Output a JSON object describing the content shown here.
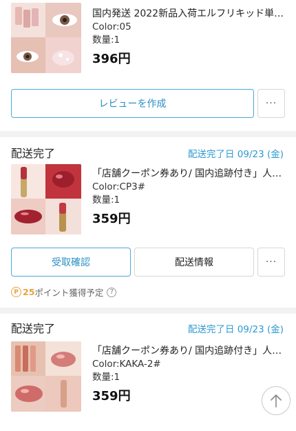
{
  "orders": [
    {
      "product": {
        "title": "国内発送 2022新品入荷エルフリキッド単色ア…",
        "color": "Color:05",
        "quantity": "数量:1",
        "price": "396円",
        "thumb_icon": "eyeshadow-product-photo"
      },
      "buttons": {
        "review": "レビューを作成",
        "more": "···"
      }
    },
    {
      "status": "配送完了",
      "delivery_date": "配送完了日 09/23 (金)",
      "product": {
        "title": "「店舗クーポン券あり/ 国内追跡付き」人気…",
        "color": "Color:CP3#",
        "quantity": "数量:1",
        "price": "359円",
        "thumb_icon": "lip-tint-product-photo"
      },
      "buttons": {
        "receive": "受取確認",
        "shipping": "配送情報",
        "more": "···"
      },
      "points": {
        "badge": "P",
        "amount": "25",
        "text": "ポイント獲得予定",
        "help": "?"
      }
    },
    {
      "status": "配送完了",
      "delivery_date": "配送完了日 09/23 (金)",
      "product": {
        "title": "「店舗クーポン券あり/ 国内追跡付き」人気…",
        "color": "Color:KAKA-2#",
        "quantity": "数量:1",
        "price": "359円",
        "thumb_icon": "lip-gloss-product-photo"
      }
    }
  ],
  "colors": {
    "accent": "#2b9ad0",
    "points": "#e8a23c"
  },
  "scroll_top_icon": "arrow-up-icon"
}
